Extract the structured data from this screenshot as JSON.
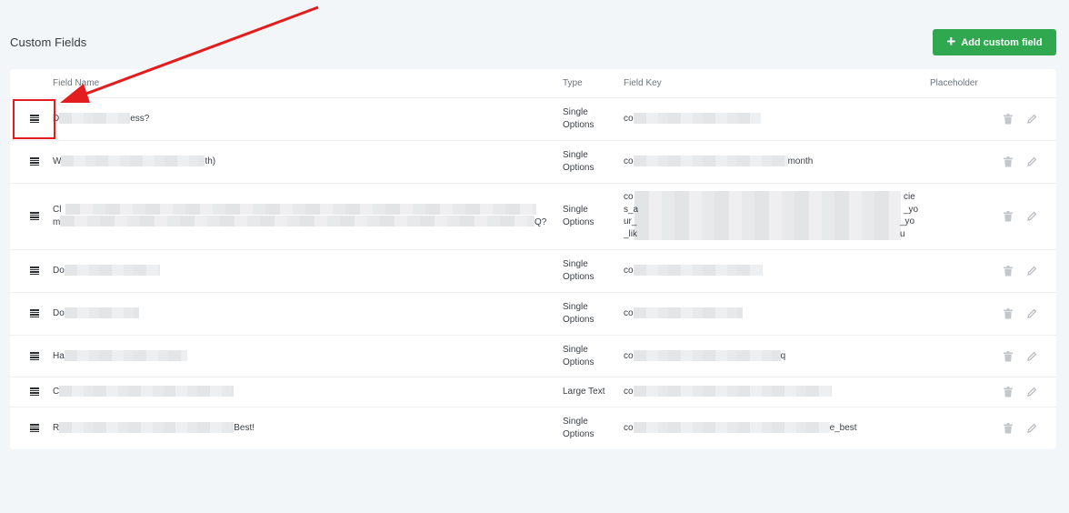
{
  "page": {
    "title": "Custom Fields"
  },
  "toolbar": {
    "add_label": "Add custom field",
    "add_icon": "plus-icon"
  },
  "table": {
    "headers": {
      "name": "Field Name",
      "type": "Type",
      "key": "Field Key",
      "placeholder": "Placeholder"
    },
    "rows": [
      {
        "name_start": "D",
        "name_end": "ess?",
        "type_line1": "Single",
        "type_line2": "Options",
        "key_start": "co",
        "key_end": ""
      },
      {
        "name_start": "W",
        "name_end": "th)",
        "type_line1": "Single",
        "type_line2": "Options",
        "key_start": "co",
        "key_end": "month"
      },
      {
        "name_start": "Cl",
        "name_line2_start": "m",
        "name_end": "Q?",
        "type_line1": "Single",
        "type_line2": "Options",
        "key_start": "co",
        "key_line2": "s_a",
        "key_line3": "ur_",
        "key_line4": "_lik",
        "key_end1": "cie",
        "key_end2": "_yo",
        "key_end3": "_you"
      },
      {
        "name_start": "Do",
        "name_end": "",
        "type_line1": "Single",
        "type_line2": "Options",
        "key_start": "co",
        "key_end": ""
      },
      {
        "name_start": "Do",
        "name_end": "",
        "type_line1": "Single",
        "type_line2": "Options",
        "key_start": "co",
        "key_end": ""
      },
      {
        "name_start": "Ha",
        "name_end": "",
        "type_line1": "Single",
        "type_line2": "Options",
        "key_start": "co",
        "key_end": "q"
      },
      {
        "name_start": "C",
        "name_end": "",
        "type_line1": "Large Text",
        "type_line2": "",
        "key_start": "co",
        "key_end": ""
      },
      {
        "name_start": "R",
        "name_end": "Best!",
        "type_line1": "Single",
        "type_line2": "Options",
        "key_start": "co",
        "key_end": "e_best"
      }
    ]
  },
  "icons": {
    "drag": "drag-handle-icon",
    "delete": "trash-icon",
    "edit": "pencil-icon"
  },
  "colors": {
    "accent": "#2fa84f",
    "annotation": "#e31d1d",
    "background": "#f3f6f9"
  }
}
